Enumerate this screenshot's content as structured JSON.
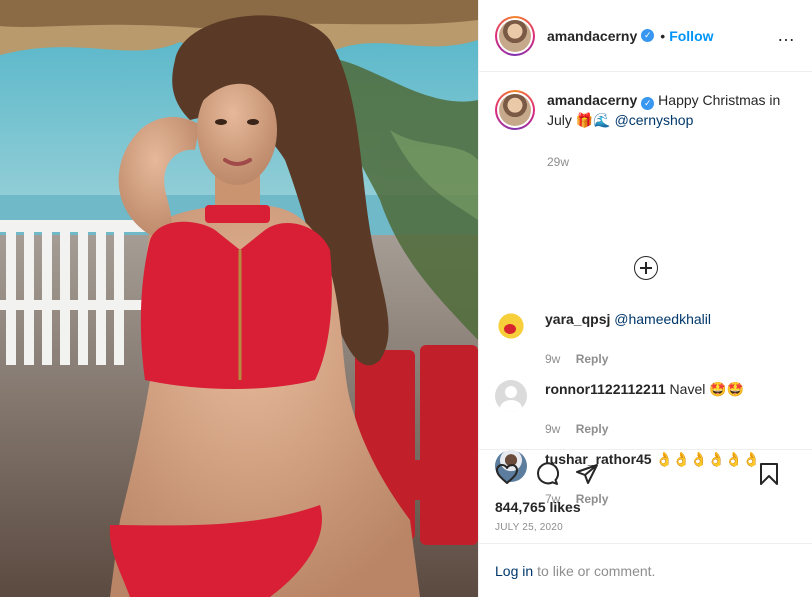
{
  "post": {
    "username": "amandacerny",
    "verified_badge": "✓",
    "separator": "•",
    "follow_label": "Follow",
    "more_icon": "…"
  },
  "caption": {
    "username": "amandacerny",
    "text": "Happy Christmas in July",
    "emoji": "🎁🌊",
    "mention": "@cernyshop",
    "time": "29w"
  },
  "comments": [
    {
      "username": "yara_qpsj",
      "text": "@hameedkhalil",
      "is_mention": true,
      "time": "9w",
      "reply_label": "Reply"
    },
    {
      "username": "ronnor1122112211",
      "text": "Navel 🤩🤩",
      "is_mention": false,
      "time": "9w",
      "reply_label": "Reply"
    },
    {
      "username": "tushar_rathor45",
      "text": "👌👌👌👌👌👌",
      "is_mention": false,
      "time": "7w",
      "reply_label": "Reply"
    }
  ],
  "engagement": {
    "likes": "844,765 likes",
    "date": "JULY 25, 2020"
  },
  "login": {
    "link": "Log in",
    "text": "to like or comment."
  },
  "colors": {
    "link_blue": "#0095f6",
    "mention_blue": "#00376b",
    "muted_gray": "#8e8e8e",
    "bikini_red": "#d81f35"
  }
}
